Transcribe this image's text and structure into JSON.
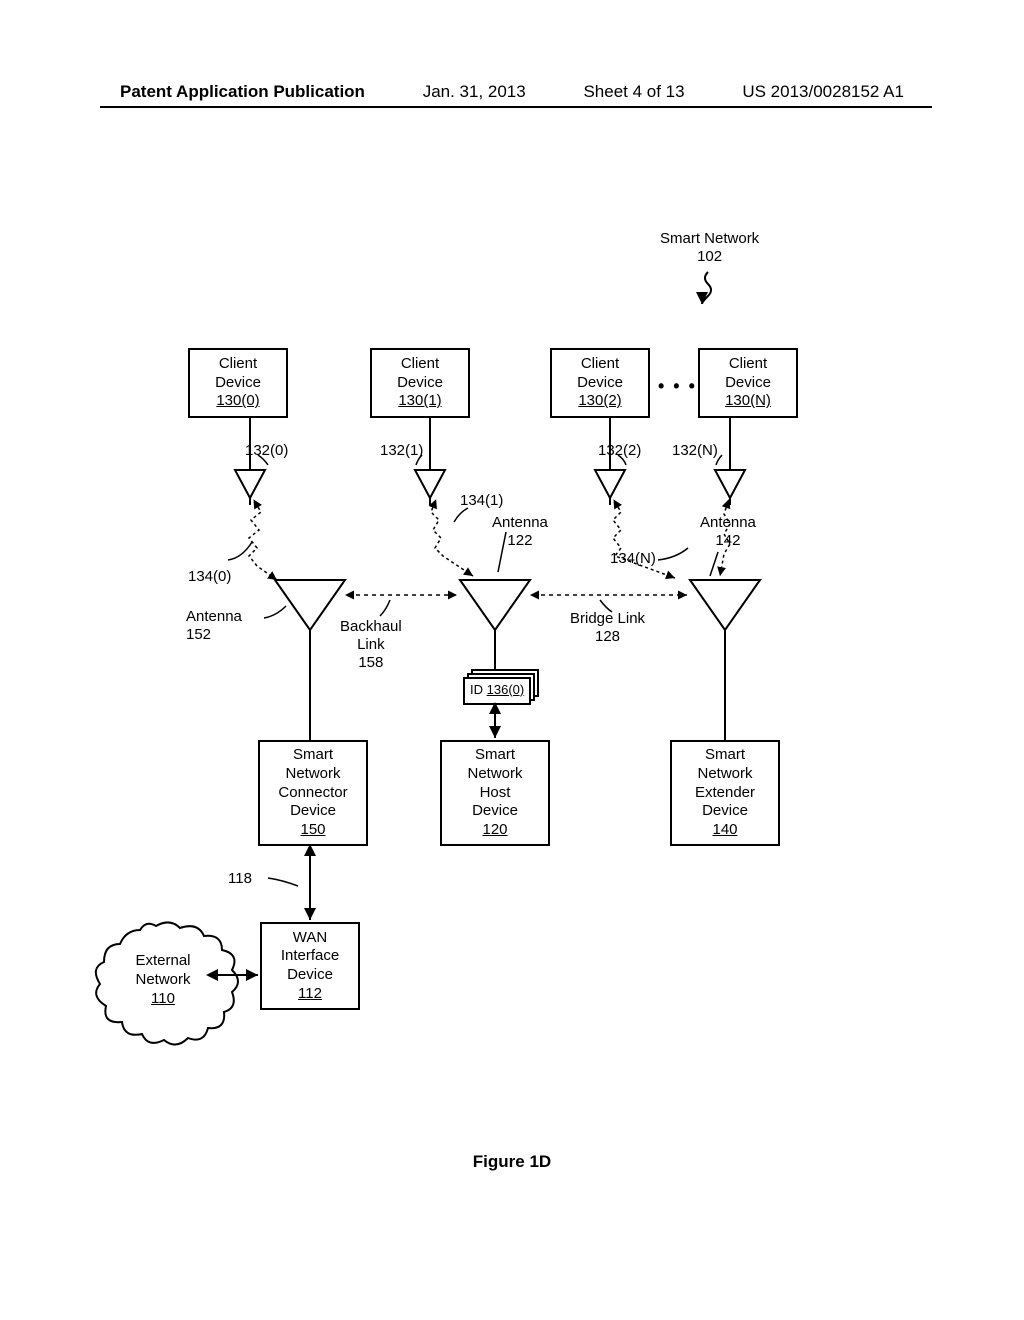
{
  "header": {
    "publication": "Patent Application Publication",
    "date": "Jan. 31, 2013",
    "sheet": "Sheet 4 of 13",
    "docnum": "US 2013/0028152 A1"
  },
  "figure_label": "Figure 1D",
  "title": {
    "line1": "Smart Network",
    "ref": "102"
  },
  "clients": [
    {
      "name": "Client\nDevice",
      "ref": "130(0)",
      "ant": "132(0)"
    },
    {
      "name": "Client\nDevice",
      "ref": "130(1)",
      "ant": "132(1)"
    },
    {
      "name": "Client\nDevice",
      "ref": "130(2)",
      "ant": "132(2)"
    },
    {
      "name": "Client\nDevice",
      "ref": "130(N)",
      "ant": "132(N)"
    }
  ],
  "ellipsis": "• • •",
  "links": {
    "c0": "134(0)",
    "c1": "134(1)",
    "cN": "134(N)"
  },
  "antennas": {
    "a152": {
      "label": "Antenna",
      "ref": "152"
    },
    "a122": {
      "label": "Antenna",
      "ref": "122"
    },
    "a142": {
      "label": "Antenna",
      "ref": "142"
    }
  },
  "link_labels": {
    "backhaul": {
      "label": "Backhaul\nLink",
      "ref": "158"
    },
    "bridge": {
      "label": "Bridge Link",
      "ref": "128"
    }
  },
  "id_box": {
    "label": "ID",
    "ref": "136(0)"
  },
  "devices": {
    "connector": {
      "lines": [
        "Smart",
        "Network",
        "Connector",
        "Device"
      ],
      "ref": "150"
    },
    "host": {
      "lines": [
        "Smart",
        "Network",
        "Host",
        "Device"
      ],
      "ref": "120"
    },
    "extender": {
      "lines": [
        "Smart",
        "Network",
        "Extender",
        "Device"
      ],
      "ref": "140"
    }
  },
  "wan_link": "118",
  "wan": {
    "lines": [
      "WAN",
      "Interface",
      "Device"
    ],
    "ref": "112"
  },
  "external": {
    "label": "External\nNetwork",
    "ref": "110"
  }
}
